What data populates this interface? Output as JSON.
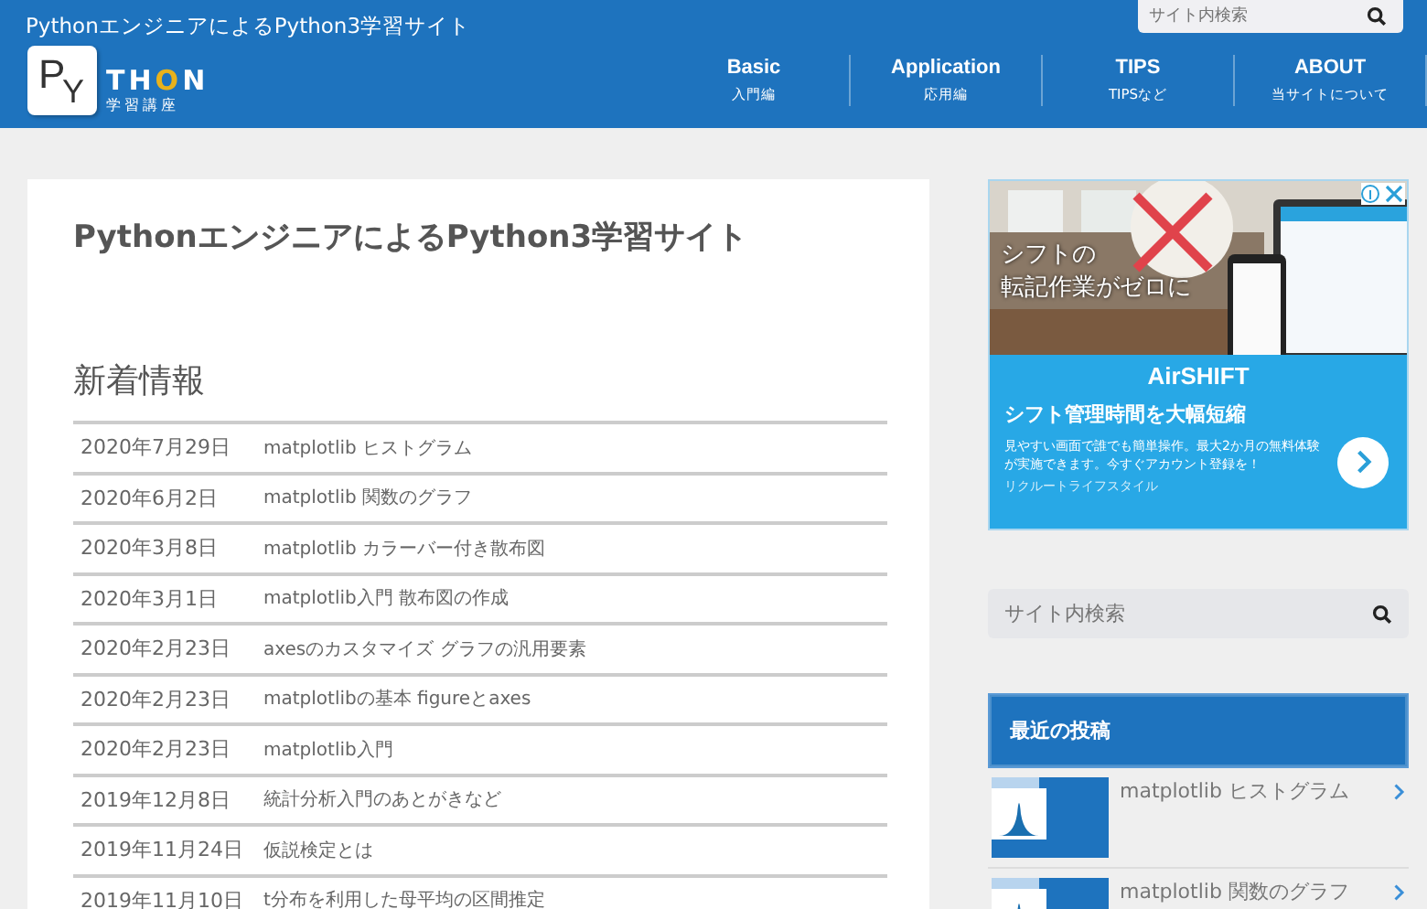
{
  "header": {
    "site_title": "PythonエンジニアによるPython3学習サイト",
    "search": {
      "placeholder": "サイト内検索"
    },
    "logo": {
      "letters_p": "P",
      "letter_y": "Y",
      "rest": "TH",
      "o": "O",
      "n": "N",
      "subtitle": "学習講座"
    },
    "nav": [
      {
        "label": "Basic",
        "sub": "入門編"
      },
      {
        "label": "Application",
        "sub": "応用編"
      },
      {
        "label": "TIPS",
        "sub": "TIPSなど"
      },
      {
        "label": "ABOUT",
        "sub": "当サイトについて"
      }
    ]
  },
  "main": {
    "title": "PythonエンジニアによるPython3学習サイト",
    "news_heading": "新着情報",
    "news": [
      {
        "date": "2020年7月29日",
        "title": "matplotlib ヒストグラム"
      },
      {
        "date": "2020年6月2日",
        "title": "matplotlib 関数のグラフ"
      },
      {
        "date": "2020年3月8日",
        "title": "matplotlib カラーバー付き散布図"
      },
      {
        "date": "2020年3月1日",
        "title": "matplotlib入門 散布図の作成"
      },
      {
        "date": "2020年2月23日",
        "title": "axesのカスタマイズ グラフの汎用要素"
      },
      {
        "date": "2020年2月23日",
        "title": "matplotlibの基本 figureとaxes"
      },
      {
        "date": "2020年2月23日",
        "title": "matplotlib入門"
      },
      {
        "date": "2019年12月8日",
        "title": "統計分析入門のあとがきなど"
      },
      {
        "date": "2019年11月24日",
        "title": "仮説検定とは"
      },
      {
        "date": "2019年11月10日",
        "title": "t分布を利用した母平均の区間推定"
      }
    ]
  },
  "sidebar": {
    "ad": {
      "overlay": [
        "シフトの",
        "転記作業がゼロに"
      ],
      "brand": "AirSHIFT",
      "headline": "シフト管理時間を大幅短縮",
      "body": "見やすい画面で誰でも簡単操作。最大2か月の無料体験が実施できます。今すぐアカウント登録を！",
      "advertiser": "リクルートライフスタイル"
    },
    "search": {
      "placeholder": "サイト内検索"
    },
    "recent_heading": "最近の投稿",
    "recent": [
      {
        "title": "matplotlib ヒストグラム"
      },
      {
        "title": "matplotlib 関数のグラフ"
      }
    ]
  }
}
